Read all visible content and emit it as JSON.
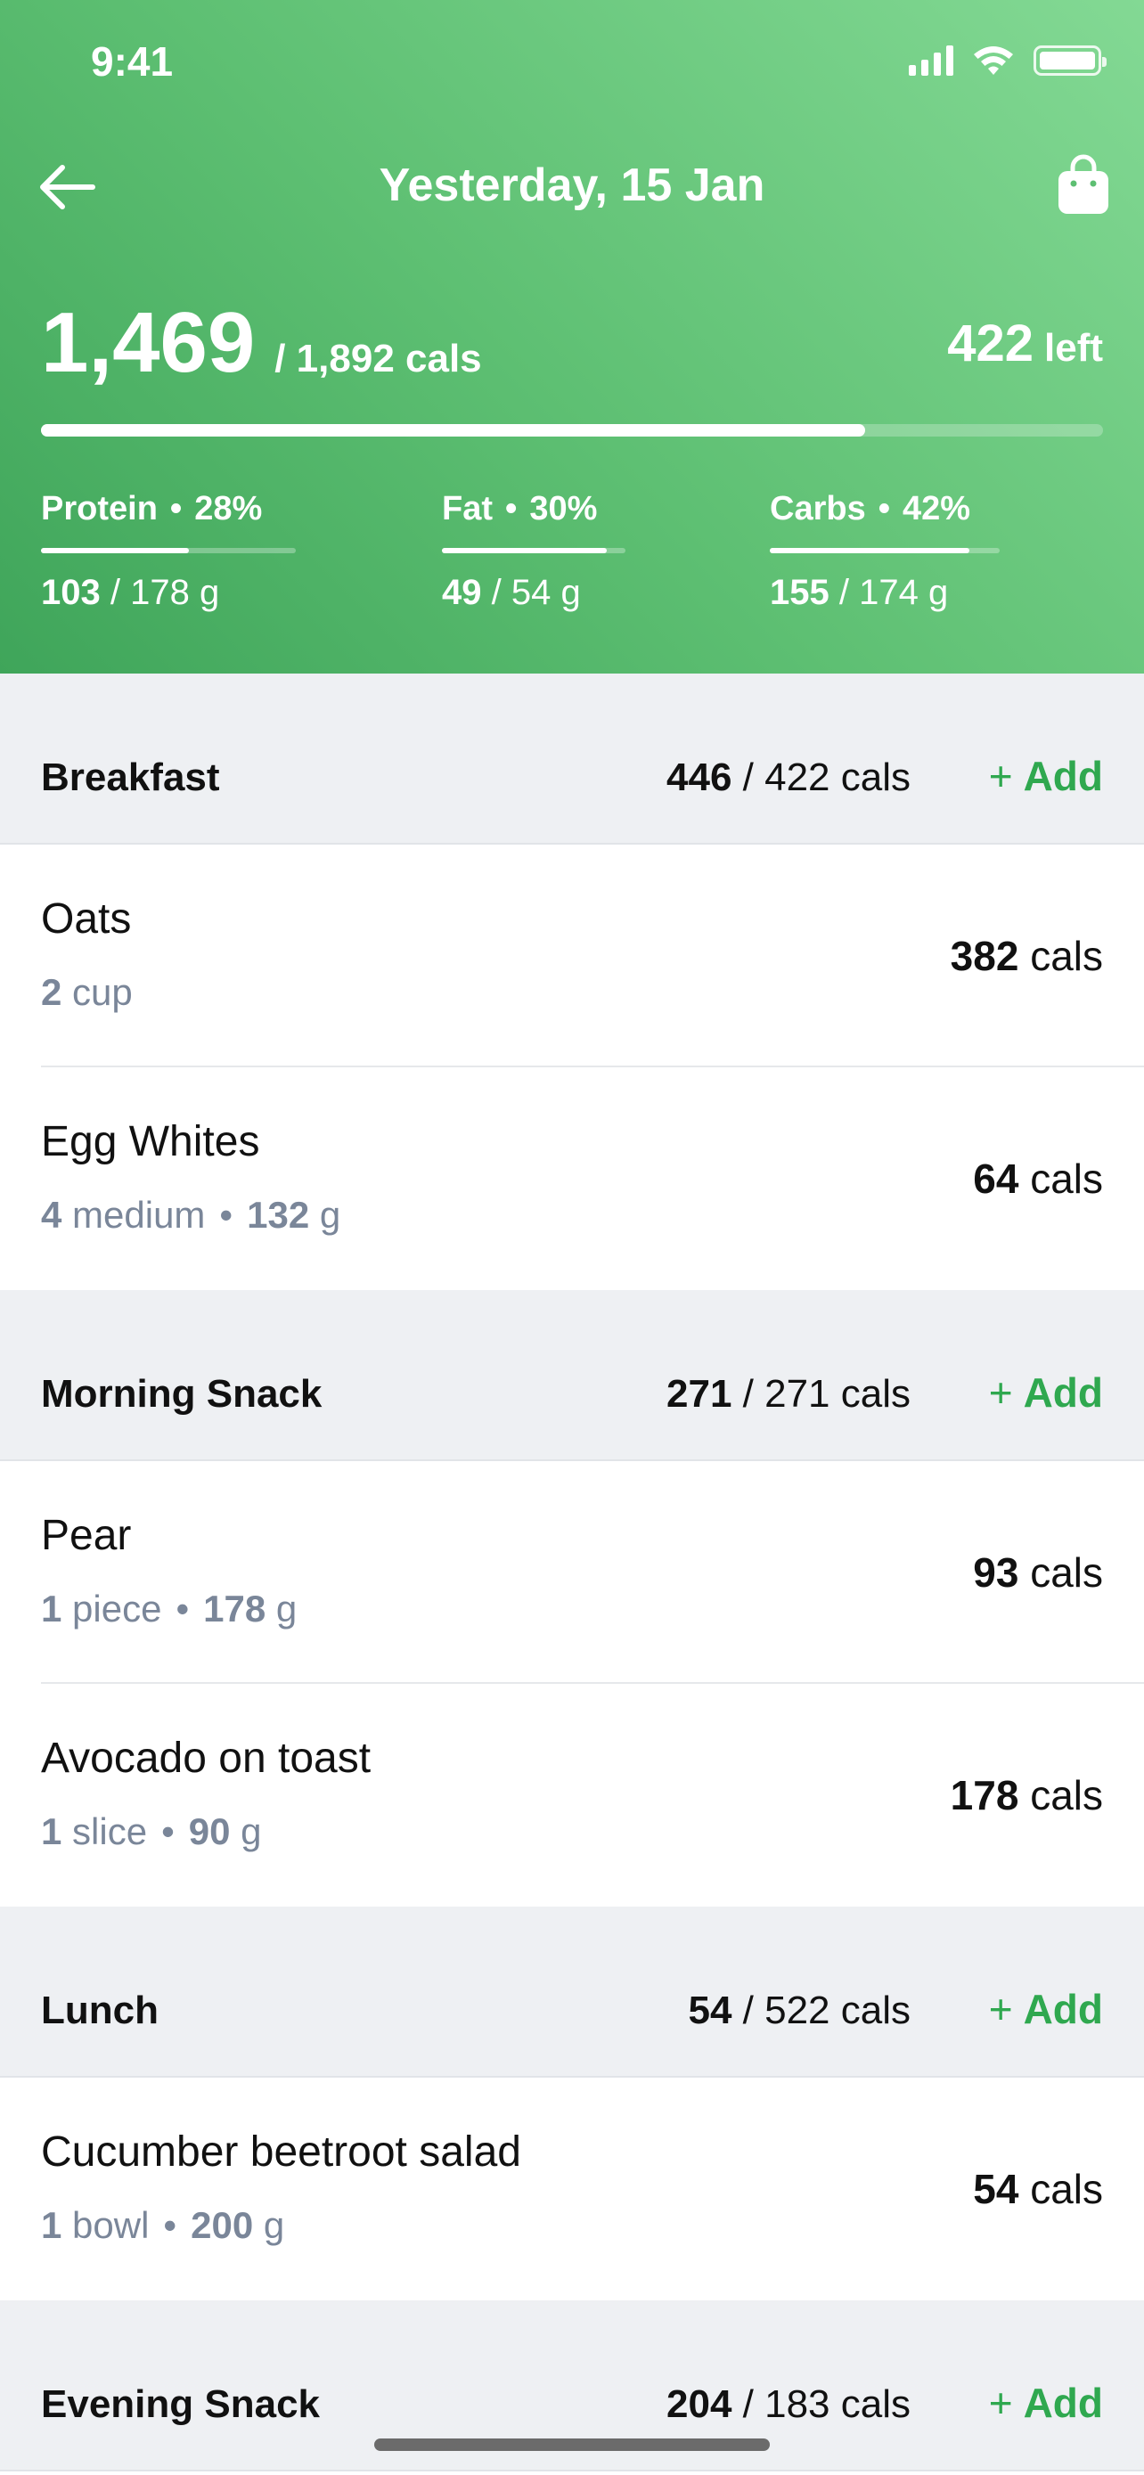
{
  "status_bar": {
    "time": "9:41"
  },
  "nav": {
    "title": "Yesterday, 15 Jan"
  },
  "summary": {
    "eaten": "1,469",
    "goal": "/ 1,892 cals",
    "remaining": "422",
    "remaining_label": "left",
    "progress_fraction": 0.776
  },
  "macros": [
    {
      "name": "Protein",
      "percent": "28%",
      "amount": "103",
      "target": "/ 178 g",
      "fill_fraction": 0.58
    },
    {
      "name": "Fat",
      "percent": "30%",
      "amount": "49",
      "target": "/ 54 g",
      "fill_fraction": 0.9
    },
    {
      "name": "Carbs",
      "percent": "42%",
      "amount": "155",
      "target": "/ 174 g",
      "fill_fraction": 0.87
    }
  ],
  "separator_dot": "•",
  "add_label": "Add",
  "add_plus": "+",
  "meals": [
    {
      "name": "Breakfast",
      "eaten": "446",
      "target": "/ 422 cals",
      "items": [
        {
          "name": "Oats",
          "qty": "2",
          "unit": "cup",
          "weight": "",
          "weight_unit": "",
          "cals": "382",
          "cals_unit": "cals"
        },
        {
          "name": "Egg Whites",
          "qty": "4",
          "unit": "medium",
          "weight": "132",
          "weight_unit": "g",
          "cals": "64",
          "cals_unit": "cals"
        }
      ]
    },
    {
      "name": "Morning Snack",
      "eaten": "271",
      "target": "/ 271 cals",
      "items": [
        {
          "name": "Pear",
          "qty": "1",
          "unit": "piece",
          "weight": "178",
          "weight_unit": "g",
          "cals": "93",
          "cals_unit": "cals"
        },
        {
          "name": "Avocado on toast",
          "qty": "1",
          "unit": "slice",
          "weight": "90",
          "weight_unit": "g",
          "cals": "178",
          "cals_unit": "cals"
        }
      ]
    },
    {
      "name": "Lunch",
      "eaten": "54",
      "target": "/ 522 cals",
      "items": [
        {
          "name": "Cucumber beetroot salad",
          "qty": "1",
          "unit": "bowl",
          "weight": "200",
          "weight_unit": "g",
          "cals": "54",
          "cals_unit": "cals"
        }
      ]
    },
    {
      "name": "Evening Snack",
      "eaten": "204",
      "target": "/ 183 cals",
      "items": []
    }
  ],
  "icons": {
    "back": "back-arrow-icon",
    "bag": "shopping-bag-icon",
    "signal": "cellular-signal-icon",
    "wifi": "wifi-icon",
    "battery": "battery-icon"
  },
  "colors": {
    "header_gradient_start": "#83d994",
    "header_gradient_end": "#3fa55a",
    "accent": "#2fa84f",
    "section_bg": "#eef0f3",
    "muted_text": "#7a8699"
  }
}
